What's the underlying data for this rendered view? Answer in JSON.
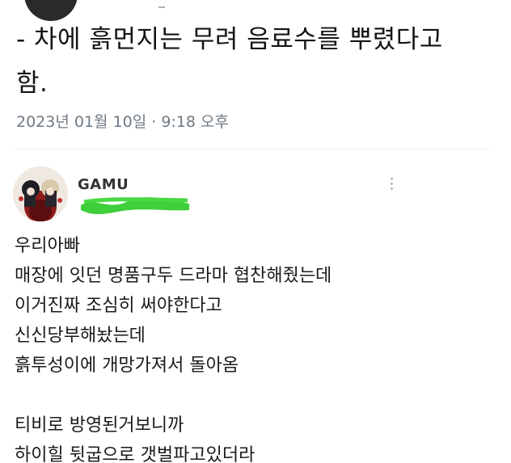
{
  "previous_tweet": {
    "text_lines": [
      "- 차에 흙먼지는 무려 음료수를 뿌렸다고",
      "함."
    ],
    "timestamp": "2023년 01월 10일 · 9:18 오후"
  },
  "comment": {
    "username": "GAMU",
    "handle_redaction_color": "#3fcf3a",
    "menu_icon": "kebab-vertical-icon",
    "body_block1": [
      "우리아빠",
      "매장에 잇던 명품구두 드라마 협찬해줬는데",
      "이거진짜 조심히 써야한다고",
      "신신당부해놨는데",
      "흙투성이에 개망가져서 돌아옴"
    ],
    "body_block2": [
      "티비로 방영된거보니까",
      "하이힐 뒷굽으로 갯벌파고있더라"
    ]
  }
}
